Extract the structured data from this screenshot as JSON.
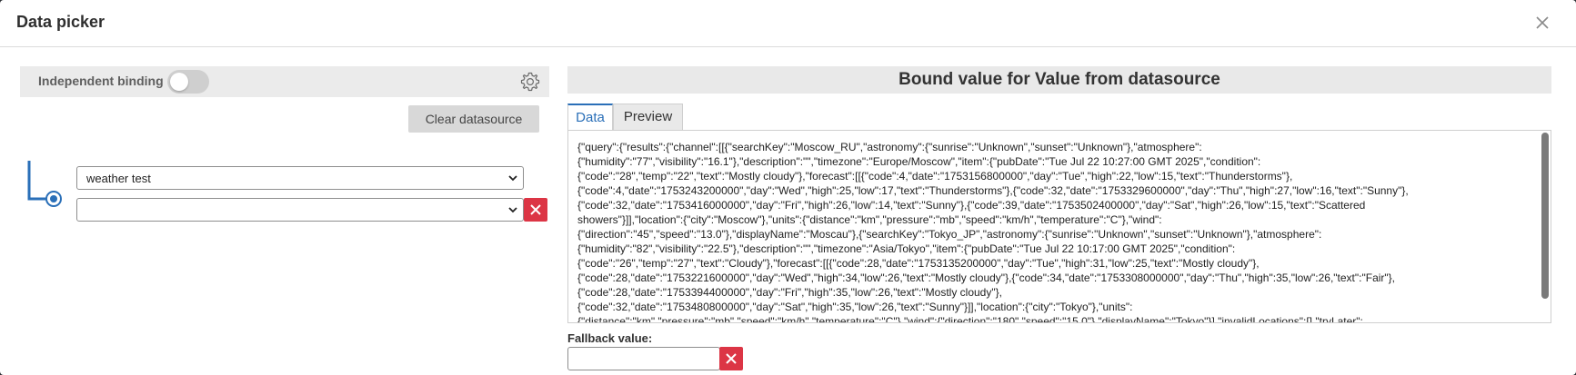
{
  "dialog": {
    "title": "Data picker"
  },
  "binding": {
    "independent_label": "Independent binding",
    "independent_on": false,
    "clear_label": "Clear datasource",
    "datasource_selected": "weather test",
    "field_selected": ""
  },
  "bound": {
    "header": "Bound value for Value from datasource",
    "tabs": [
      "Data",
      "Preview"
    ],
    "active_tab": "Data",
    "data_text": "{\"query\":{\"results\":{\"channel\":[[{\"searchKey\":\"Moscow_RU\",\"astronomy\":{\"sunrise\":\"Unknown\",\"sunset\":\"Unknown\"},\"atmosphere\":\n{\"humidity\":\"77\",\"visibility\":\"16.1\"},\"description\":\"\",\"timezone\":\"Europe/Moscow\",\"item\":{\"pubDate\":\"Tue Jul 22 10:27:00 GMT 2025\",\"condition\":\n{\"code\":\"28\",\"temp\":\"22\",\"text\":\"Mostly cloudy\"},\"forecast\":[[{\"code\":4,\"date\":\"1753156800000\",\"day\":\"Tue\",\"high\":22,\"low\":15,\"text\":\"Thunderstorms\"},\n{\"code\":4,\"date\":\"1753243200000\",\"day\":\"Wed\",\"high\":25,\"low\":17,\"text\":\"Thunderstorms\"},{\"code\":32,\"date\":\"1753329600000\",\"day\":\"Thu\",\"high\":27,\"low\":16,\"text\":\"Sunny\"},\n{\"code\":32,\"date\":\"1753416000000\",\"day\":\"Fri\",\"high\":26,\"low\":14,\"text\":\"Sunny\"},{\"code\":39,\"date\":\"1753502400000\",\"day\":\"Sat\",\"high\":26,\"low\":15,\"text\":\"Scattered\nshowers\"}]],\"location\":{\"city\":\"Moscow\"},\"units\":{\"distance\":\"km\",\"pressure\":\"mb\",\"speed\":\"km/h\",\"temperature\":\"C\"},\"wind\":\n{\"direction\":\"45\",\"speed\":\"13.0\"},\"displayName\":\"Moscau\"},{\"searchKey\":\"Tokyo_JP\",\"astronomy\":{\"sunrise\":\"Unknown\",\"sunset\":\"Unknown\"},\"atmosphere\":\n{\"humidity\":\"82\",\"visibility\":\"22.5\"},\"description\":\"\",\"timezone\":\"Asia/Tokyo\",\"item\":{\"pubDate\":\"Tue Jul 22 10:17:00 GMT 2025\",\"condition\":\n{\"code\":\"26\",\"temp\":\"27\",\"text\":\"Cloudy\"},\"forecast\":[[{\"code\":28,\"date\":\"1753135200000\",\"day\":\"Tue\",\"high\":31,\"low\":25,\"text\":\"Mostly cloudy\"},\n{\"code\":28,\"date\":\"1753221600000\",\"day\":\"Wed\",\"high\":34,\"low\":26,\"text\":\"Mostly cloudy\"},{\"code\":34,\"date\":\"1753308000000\",\"day\":\"Thu\",\"high\":35,\"low\":26,\"text\":\"Fair\"},\n{\"code\":28,\"date\":\"1753394400000\",\"day\":\"Fri\",\"high\":35,\"low\":26,\"text\":\"Mostly cloudy\"},\n{\"code\":32,\"date\":\"1753480800000\",\"day\":\"Sat\",\"high\":35,\"low\":26,\"text\":\"Sunny\"}]],\"location\":{\"city\":\"Tokyo\"},\"units\":\n{\"distance\":\"km\",\"pressure\":\"mb\",\"speed\":\"km/h\",\"temperature\":\"C\"},\"wind\":{\"direction\":\"180\",\"speed\":\"15.0\"},\"displayName\":\"Tokyo\"}],\"invalidLocations\":[],\"tryLater\":"
  },
  "fallback": {
    "label": "Fallback value:",
    "value": ""
  },
  "colors": {
    "accent": "#2a6fb8",
    "danger": "#dc3545",
    "panel": "#e9e9e9"
  },
  "icons": {
    "close": "close-icon",
    "settings": "gear-icon",
    "remove": "x-icon",
    "dropdown": "chevron-down-icon"
  }
}
